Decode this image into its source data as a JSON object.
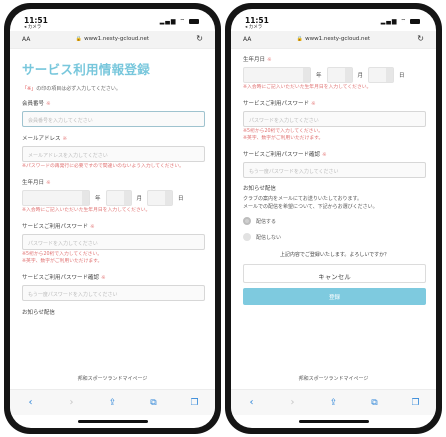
{
  "status": {
    "time": "11:51",
    "sub": "◂ カメラ"
  },
  "urlbar": {
    "aa": "AA",
    "url": "www1.nesty-gcloud.net",
    "lock_icon": "lock-icon",
    "reload_icon": "reload-icon"
  },
  "left": {
    "page_title": "サービス利用情報登録",
    "required_note_mark": "「※」",
    "required_note": "の印の項目は必ず入力してください。",
    "member_no": {
      "label": "会員番号",
      "placeholder": "会員番号を入力してください"
    },
    "email": {
      "label": "メールアドレス",
      "placeholder": "メールアドレスを入力してください",
      "error": "※パスワードの再発行に必要ですので間違いのないよう入力してください。"
    },
    "birthdate": {
      "label": "生年月日",
      "year": "年",
      "month": "月",
      "day": "日",
      "error": "※入会時にご記入いただいた生年月日を入力してください。"
    },
    "password": {
      "label": "サービスご利用パスワード",
      "placeholder": "パスワードを入力してください",
      "error1": "※5桁から20桁で入力してください。",
      "error2": "※英字、数字がご利用いただけます。"
    },
    "password_confirm": {
      "label": "サービスご利用パスワード確認",
      "placeholder": "もう一度パスワードを入力してください"
    },
    "partial_label": "お知らせ配信"
  },
  "right": {
    "birthdate": {
      "label": "生年月日",
      "year": "年",
      "month": "月",
      "day": "日",
      "error": "※入会時にご記入いただいた生年月日を入力してください。"
    },
    "password": {
      "label": "サービスご利用パスワード",
      "placeholder": "パスワードを入力してください",
      "error1": "※5桁から20桁で入力してください。",
      "error2": "※英字、数字がご利用いただけます。"
    },
    "password_confirm": {
      "label": "サービスご利用パスワード確認",
      "placeholder": "もう一度パスワードを入力してください"
    },
    "newsletter": {
      "label": "お知らせ配信",
      "desc1": "クラブの案内をメールにてお送りいたしております。",
      "desc2": "メールでの配信を希望について、下記からお選びください。",
      "opt_yes": "配信する",
      "opt_no": "配信しない",
      "selected": "配信する"
    },
    "confirm_text": "上記内容でご登録いたします。よろしいですか？",
    "cancel_label": "キャンセル",
    "submit_label": "登録"
  },
  "required_mark": "※",
  "footer_text": "邦和スポーツランドマイページ",
  "toolbar": [
    "back-icon",
    "forward-icon",
    "share-icon",
    "bookmarks-icon",
    "tabs-icon"
  ],
  "colors": {
    "accent": "#78c7dc",
    "error": "#e07070",
    "link": "#2f86d8"
  }
}
